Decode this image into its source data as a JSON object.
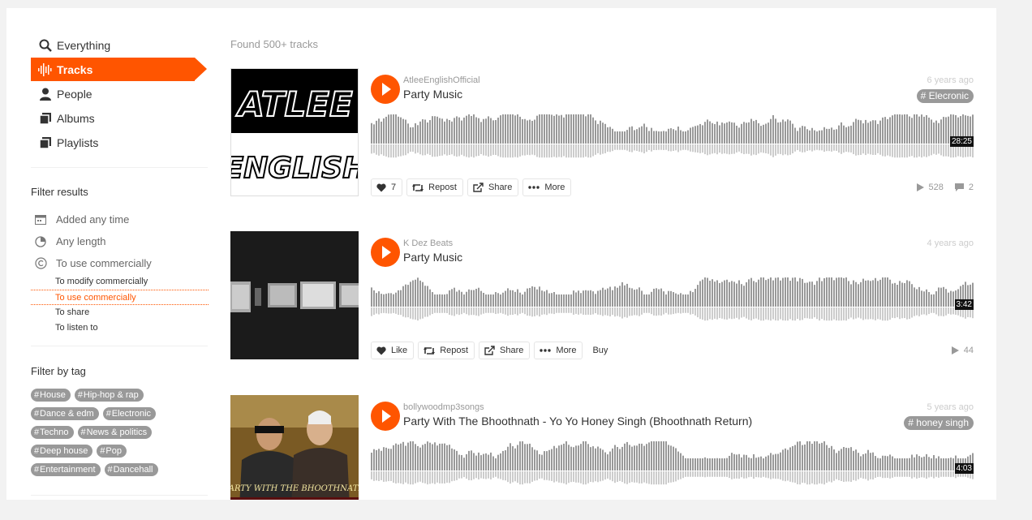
{
  "nav": [
    {
      "label": "Everything",
      "icon": "search-icon",
      "active": false
    },
    {
      "label": "Tracks",
      "icon": "sound-wave-icon",
      "active": true
    },
    {
      "label": "People",
      "icon": "person-icon",
      "active": false
    },
    {
      "label": "Albums",
      "icon": "album-icon",
      "active": false
    },
    {
      "label": "Playlists",
      "icon": "playlist-icon",
      "active": false
    }
  ],
  "filters": {
    "title": "Filter results",
    "added": "Added any time",
    "length": "Any length",
    "license": "To use commercially",
    "license_options": [
      "To modify commercially",
      "To use commercially",
      "To share",
      "To listen to"
    ],
    "license_selected": 1
  },
  "tag_filter": {
    "title": "Filter by tag",
    "tags": [
      "House",
      "Hip-hop & rap",
      "Dance & edm",
      "Electronic",
      "Techno",
      "News & politics",
      "Deep house",
      "Pop",
      "Entertainment",
      "Dancehall"
    ]
  },
  "results_label": "Found 500+ tracks",
  "tracks": [
    {
      "user": "AtleeEnglishOfficial",
      "title": "Party Music",
      "ago": "6 years ago",
      "tag": "Elecronic",
      "duration": "28:25",
      "like_label": "7",
      "repost": "Repost",
      "share": "Share",
      "more": "More",
      "buy": "",
      "plays": "528",
      "comments": "2",
      "artwork": "atlee-english-logo",
      "artwork_text": [
        "ATLEE",
        "ENGLISH"
      ]
    },
    {
      "user": "K Dez Beats",
      "title": "Party Music",
      "ago": "4 years ago",
      "tag": "",
      "duration": "3:42",
      "like_label": "Like",
      "repost": "Repost",
      "share": "Share",
      "more": "More",
      "buy": "Buy",
      "plays": "44",
      "comments": "",
      "artwork": "studio-equipment"
    },
    {
      "user": "bollywoodmp3songs",
      "title": "Party With The Bhoothnath - Yo Yo Honey Singh (Bhoothnath Return)",
      "ago": "5 years ago",
      "tag": "honey singh",
      "duration": "4:03",
      "artwork": "movie-poster",
      "artwork_text": [
        "PARTY WITH THE BHOOTHNATH"
      ]
    }
  ],
  "colors": {
    "accent": "#ff5500",
    "wave": "#999999",
    "tag_bg": "#999999"
  }
}
